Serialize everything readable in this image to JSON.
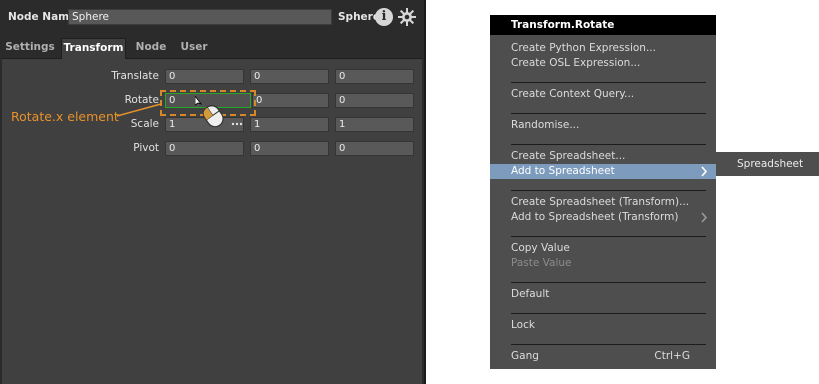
{
  "panel": {
    "header": {
      "node_name_label": "Node Name",
      "node_name_value": "Sphere",
      "node_type": "Sphere"
    },
    "tabs": [
      {
        "label": "Settings",
        "active": false
      },
      {
        "label": "Transform",
        "active": true
      },
      {
        "label": "Node",
        "active": false
      },
      {
        "label": "User",
        "active": false
      }
    ],
    "rows": [
      {
        "label": "Translate",
        "values": [
          "0",
          "0",
          "0"
        ]
      },
      {
        "label": "Rotate",
        "values": [
          "0",
          "0",
          "0"
        ]
      },
      {
        "label": "Scale",
        "values": [
          "1",
          "1",
          "1"
        ]
      },
      {
        "label": "Pivot",
        "values": [
          "0",
          "0",
          "0"
        ]
      }
    ],
    "annotation": "Rotate.x element",
    "icons": [
      "info-icon",
      "gear-icon",
      "mouse-cursor-icon"
    ]
  },
  "menu": {
    "title": "Transform.Rotate",
    "items": [
      "Create Python Expression...",
      "Create OSL Expression...",
      "Create Context Query...",
      "Randomise...",
      "Create Spreadsheet...",
      "Add to Spreadsheet",
      "Create Spreadsheet (Transform)...",
      "Add to Spreadsheet (Transform)",
      "Copy Value",
      "Paste Value",
      "Default",
      "Lock",
      "Gang"
    ],
    "gang_shortcut": "Ctrl+G",
    "highlighted_item": "Add to Spreadsheet",
    "disabled_item": "Paste Value"
  },
  "submenu": {
    "items": [
      "Spreadsheet"
    ]
  },
  "colors": {
    "panel_bg": "#404040",
    "highlight_field_border": "#28a828",
    "annotation": "#e8922a",
    "menu_hover": "#7d9cbd"
  }
}
